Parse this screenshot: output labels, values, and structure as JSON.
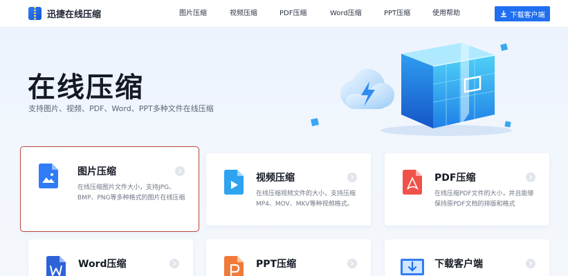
{
  "header": {
    "logo_text": "迅捷在线压缩",
    "nav": [
      {
        "label": "图片压缩"
      },
      {
        "label": "视频压缩"
      },
      {
        "label": "PDF压缩"
      },
      {
        "label": "Word压缩"
      },
      {
        "label": "PPT压缩"
      },
      {
        "label": "使用帮助"
      }
    ],
    "download_label": "下载客户端"
  },
  "hero": {
    "title": "在线压缩",
    "subtitle": "支持图片、视频、PDF、Word、PPT多种文件在线压缩"
  },
  "cards": [
    {
      "title": "图片压缩",
      "desc": "在线压缩图片文件大小，支持JPG、BMP、PNG等多种格式的图片在线压缩",
      "icon": "image-file-icon",
      "selected": true
    },
    {
      "title": "视频压缩",
      "desc": "在线压缩视频文件的大小，支持压缩MP4、MOV、MKV等种视频格式。",
      "icon": "video-file-icon",
      "selected": false
    },
    {
      "title": "PDF压缩",
      "desc": "在线压缩PDF文件的大小，并且能够保持原PDF文档的排版和格式",
      "icon": "pdf-file-icon",
      "selected": false
    },
    {
      "title": "Word压缩",
      "desc": "",
      "icon": "word-file-icon",
      "selected": false
    },
    {
      "title": "PPT压缩",
      "desc": "",
      "icon": "ppt-file-icon",
      "selected": false
    },
    {
      "title": "下载客户端",
      "desc": "",
      "icon": "monitor-download-icon",
      "selected": false
    }
  ],
  "colors": {
    "brand_blue": "#1f6ff0",
    "image_icon": "#2f7cf6",
    "video_icon": "#2fa3f0",
    "pdf_icon": "#f0524a",
    "word_icon": "#2d63d8",
    "ppt_icon": "#f07a3a",
    "selection_outline": "#b8473b"
  }
}
